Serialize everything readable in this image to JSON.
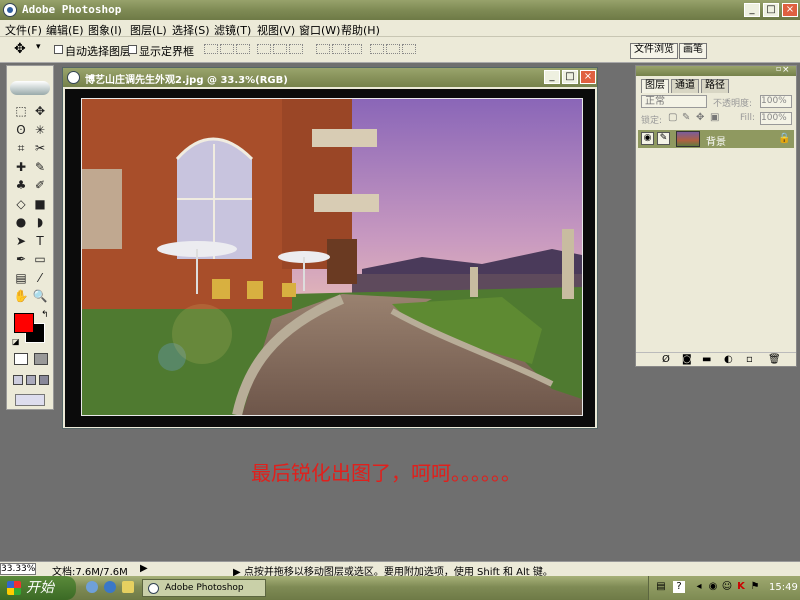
{
  "window": {
    "title": "Adobe Photoshop",
    "minimize": "_",
    "maximize": "□",
    "close": "×"
  },
  "menu": [
    "文件(F)",
    "编辑(E)",
    "图象(I)",
    "图层(L)",
    "选择(S)",
    "滤镜(T)",
    "视图(V)",
    "窗口(W)",
    "帮助(H)"
  ],
  "options": {
    "auto_select": "自动选择图层",
    "show_bounds": "显示定界框",
    "file_browser": "文件浏览",
    "brushes": "画笔"
  },
  "tools": {
    "icons": [
      "marquee-icon",
      "move-icon",
      "lasso-icon",
      "magic-wand-icon",
      "crop-icon",
      "slice-icon",
      "healing-icon",
      "brush-icon",
      "stamp-icon",
      "history-brush-icon",
      "eraser-icon",
      "gradient-icon",
      "blur-icon",
      "dodge-icon",
      "path-select-icon",
      "type-icon",
      "pen-icon",
      "shape-icon",
      "notes-icon",
      "eyedropper-icon",
      "hand-icon",
      "zoom-icon"
    ],
    "glyphs": [
      "⬚",
      "✥",
      "ʘ",
      "✳",
      "⌗",
      "✂",
      "✚",
      "✎",
      "♣",
      "✐",
      "◇",
      "■",
      "●",
      "◗",
      "➤",
      "T",
      "✒",
      "▭",
      "▤",
      "⁄",
      "✋",
      "🔍"
    ],
    "foreground": "#ff0000",
    "background": "#000000"
  },
  "document": {
    "title": "博艺山庄调先生外观2.jpg @ 33.3%(RGB)"
  },
  "layers_panel": {
    "tabs": [
      "图层",
      "通道",
      "路径"
    ],
    "blend_mode": "正常",
    "opacity_label": "不透明度:",
    "opacity_value": "100%",
    "lock_label": "锁定:",
    "fill_label": "Fill:",
    "fill_value": "100%",
    "layer_name": "背景"
  },
  "annotation": "最后锐化出图了，呵呵。。。。。。",
  "status": {
    "zoom": "33.33%",
    "doc_size": "文档:7.6M/7.6M",
    "hint": "▶ 点按并拖移以移动图层或选区。要用附加选项，使用 Shift 和 Alt 键。"
  },
  "taskbar": {
    "start": "开始",
    "task_ps": "Adobe Photoshop",
    "clock": "15:49"
  },
  "colors": {
    "title_bar": "#7f8b55",
    "panel_bg": "#ecead8",
    "desktop": "#6f6f6f",
    "annotation": "#e0201c"
  }
}
